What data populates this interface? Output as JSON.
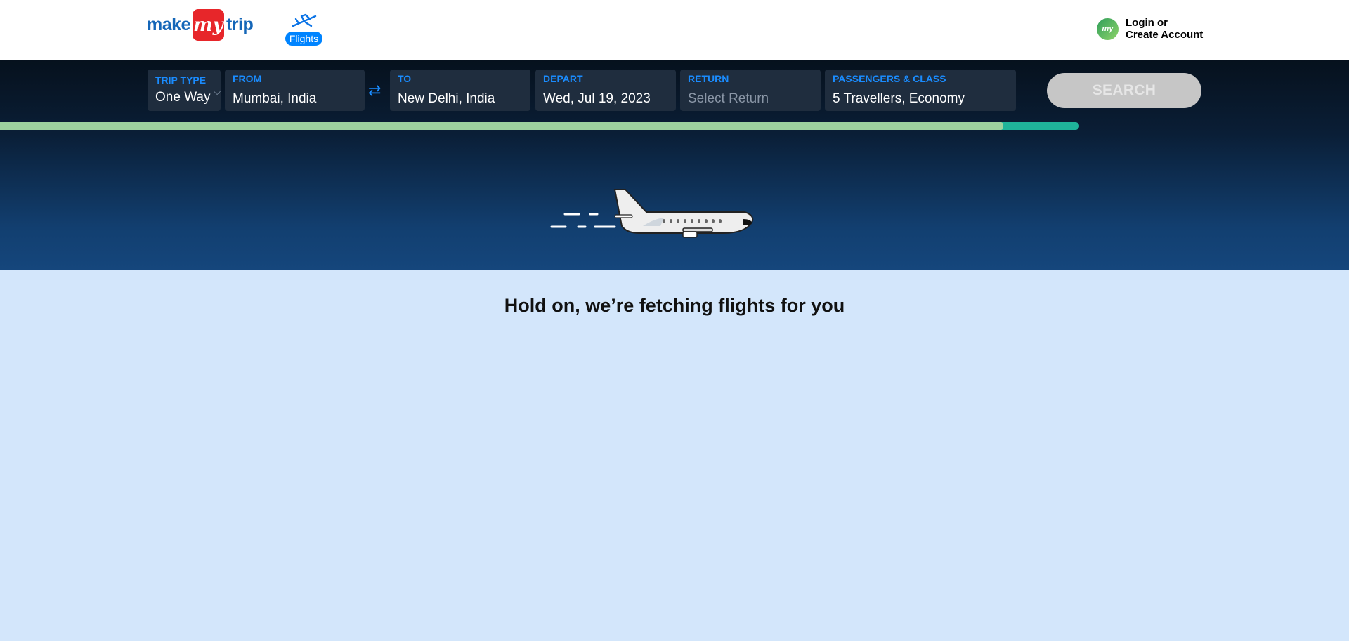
{
  "header": {
    "logo": {
      "make": "make",
      "my": "my",
      "trip": "trip"
    },
    "nav": {
      "flights_label": "Flights",
      "icon": "airplane-icon"
    },
    "account": {
      "line1": "Login or",
      "line2": "Create Account",
      "avatar_text": "my"
    }
  },
  "search": {
    "trip_type": {
      "label": "TRIP TYPE",
      "value": "One Way"
    },
    "from": {
      "label": "FROM",
      "value": "Mumbai, India"
    },
    "swap_icon": "⇄",
    "to": {
      "label": "TO",
      "value": "New Delhi, India"
    },
    "depart": {
      "label": "DEPART",
      "value": "Wed, Jul 19, 2023"
    },
    "return": {
      "label": "RETURN",
      "placeholder": "Select Return"
    },
    "passengers": {
      "label": "PASSENGERS & CLASS",
      "value": "5 Travellers, Economy"
    },
    "button_label": "SEARCH"
  },
  "progress": {
    "fraction": 0.93
  },
  "main": {
    "loading_text": "Hold on, we’re fetching flights for you"
  },
  "colors": {
    "accent": "#1a8cff",
    "brand_red": "#e7262a",
    "background": "#d3e6fb"
  }
}
